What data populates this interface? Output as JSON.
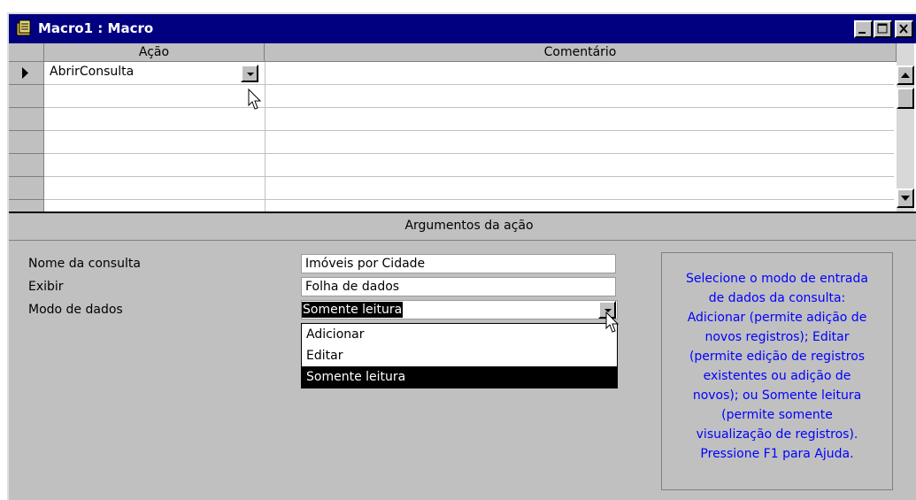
{
  "window": {
    "title": "Macro1 : Macro",
    "controls": [
      "minimize",
      "maximize",
      "close"
    ]
  },
  "grid": {
    "columns": [
      "Ação",
      "Comentário"
    ],
    "rows": [
      {
        "acao": "AbrirConsulta",
        "comentario": "",
        "current": true
      },
      {
        "acao": "",
        "comentario": ""
      },
      {
        "acao": "",
        "comentario": ""
      },
      {
        "acao": "",
        "comentario": ""
      },
      {
        "acao": "",
        "comentario": ""
      },
      {
        "acao": "",
        "comentario": ""
      }
    ]
  },
  "arguments": {
    "header": "Argumentos da ação",
    "fields": [
      {
        "label": "Nome da consulta",
        "value": "Imóveis por Cidade"
      },
      {
        "label": "Exibir",
        "value": "Folha de dados"
      },
      {
        "label": "Modo de dados",
        "value": "Somente leitura"
      }
    ],
    "dropdown_options": [
      "Adicionar",
      "Editar",
      "Somente leitura"
    ],
    "selected_option_index": 2
  },
  "help": {
    "lines": [
      "Selecione o modo de entrada",
      "de dados da consulta:",
      "Adicionar (permite adição de",
      "novos registros); Editar",
      "(permite edição de registros",
      "existentes ou adição de",
      "novos); ou Somente leitura",
      "(permite somente",
      "visualização de registros).",
      "Pressione F1 para Ajuda."
    ]
  },
  "colors": {
    "titlebar": "#000080",
    "face": "#c0c0c0",
    "help_text": "#0000ff",
    "selection": "#000000"
  },
  "icons": [
    "macro-app-icon",
    "row-pointer-icon",
    "dropdown-arrow-icon",
    "scroll-up-icon",
    "scroll-down-icon",
    "mouse-pointer-icon"
  ]
}
